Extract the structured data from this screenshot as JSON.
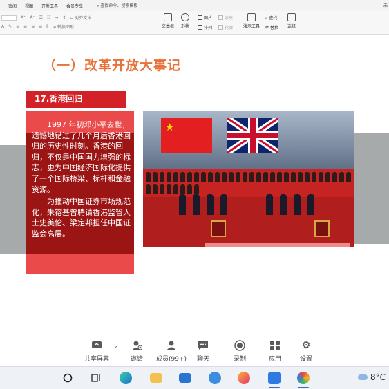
{
  "menubar": {
    "items": [
      "审阅",
      "视图",
      "开发工具",
      "会员专享"
    ],
    "search": "查找命令、搜索模板",
    "right_text": "未"
  },
  "ribbon": {
    "tools": [
      {
        "label": "文本框"
      },
      {
        "label": "形状"
      },
      {
        "label": "排列"
      },
      {
        "label": "演示工具"
      },
      {
        "label": "替换"
      },
      {
        "label": "选择"
      }
    ],
    "small": {
      "picture": "图片",
      "fill": "填充",
      "find": "查找",
      "outline": "轮廓",
      "align_text": "对齐文本",
      "convert_smartart": "转换图形"
    }
  },
  "slide": {
    "title": "（一）改革开放大事记",
    "subtitle": "17.香港回归",
    "paragraphs": [
      "1997 年初邓小平去世，遗憾地错过了几个月后香港回归的历史性时刻。香港的回归，不仅是中国国力增强的标志，更为中国经济国际化提供了一个国际桥梁、标杆和金融资源。",
      "为推动中国证券市场规范化，朱镕基曾聘请香港监管人士史美伦、梁定邦担任中国证监会高层。"
    ]
  },
  "meeting": {
    "buttons": [
      {
        "label": "共享屏幕",
        "icon": "share-screen-icon"
      },
      {
        "label": "邀请",
        "icon": "invite-icon"
      },
      {
        "label": "成员(99+)",
        "icon": "members-icon"
      },
      {
        "label": "聊天",
        "icon": "chat-icon"
      },
      {
        "label": "录制",
        "icon": "record-icon"
      },
      {
        "label": "应用",
        "icon": "apps-icon"
      },
      {
        "label": "设置",
        "icon": "settings-icon"
      }
    ]
  },
  "taskbar": {
    "weather": "8°C",
    "apps": [
      "start-icon",
      "task-view-icon",
      "edge-icon",
      "file-explorer-icon",
      "mail-icon",
      "browser-icon",
      "firefox-icon",
      "meeting-app-icon",
      "paint-icon"
    ]
  },
  "colors": {
    "title": "#e8733a",
    "badge": "#d32128",
    "text_box": "#ea4a4a",
    "text_box_dark": "#9c1515",
    "taskbar_active": "#2f6bd8"
  }
}
